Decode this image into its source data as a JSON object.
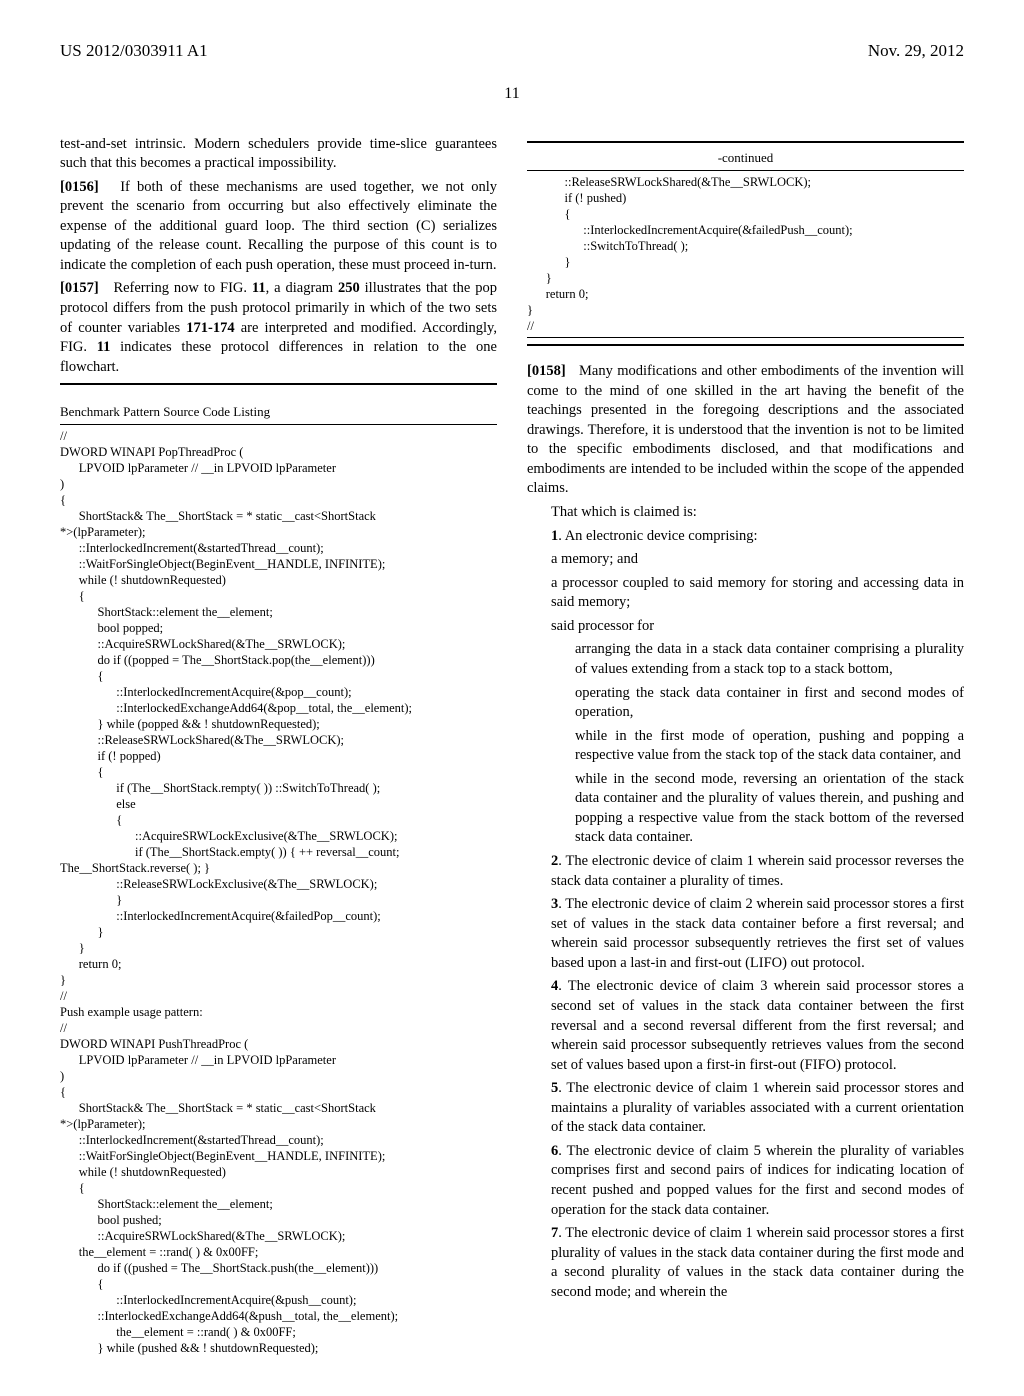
{
  "header": {
    "pub_number": "US 2012/0303911 A1",
    "pub_date": "Nov. 29, 2012"
  },
  "page_number": "11",
  "left": {
    "p1": "test-and-set intrinsic. Modern schedulers provide time-slice guarantees such that this becomes a practical impossibility.",
    "p2_num": "[0156]",
    "p2": "If both of these mechanisms are used together, we not only prevent the scenario from occurring but also effectively eliminate the expense of the additional guard loop. The third section (C) serializes updating of the release count. Recalling the purpose of this count is to indicate the completion of each push operation, these must proceed in-turn.",
    "p3_num": "[0157]",
    "p3a": "Referring now to FIG. ",
    "p3b": "11",
    "p3c": ", a diagram ",
    "p3d": "250",
    "p3e": " illustrates that the pop protocol differs from the push protocol primarily in which of the two sets of counter variables ",
    "p3f": "171-174",
    "p3g": " are interpreted and modified. Accordingly, FIG. ",
    "p3h": "11",
    "p3i": " indicates these protocol differences in relation to the one flowchart.",
    "code_title": "Benchmark Pattern Source Code Listing",
    "code": "//\nDWORD WINAPI PopThreadProc (\n      LPVOID lpParameter // __in LPVOID lpParameter\n)\n{\n      ShortStack& The__ShortStack = * static__cast<ShortStack\n*>(lpParameter);\n      ::InterlockedIncrement(&startedThread__count);\n      ::WaitForSingleObject(BeginEvent__HANDLE, INFINITE);\n      while (! shutdownRequested)\n      {\n            ShortStack::element the__element;\n            bool popped;\n            ::AcquireSRWLockShared(&The__SRWLOCK);\n            do if ((popped = The__ShortStack.pop(the__element)))\n            {\n                  ::InterlockedIncrementAcquire(&pop__count);\n                  ::InterlockedExchangeAdd64(&pop__total, the__element);\n            } while (popped && ! shutdownRequested);\n            ::ReleaseSRWLockShared(&The__SRWLOCK);\n            if (! popped)\n            {\n                  if (The__ShortStack.rempty( )) ::SwitchToThread( );\n                  else\n                  {\n                        ::AcquireSRWLockExclusive(&The__SRWLOCK);\n                        if (The__ShortStack.empty( )) { ++ reversal__count;\nThe__ShortStack.reverse( ); }\n                  ::ReleaseSRWLockExclusive(&The__SRWLOCK);\n                  }\n                  ::InterlockedIncrementAcquire(&failedPop__count);\n            }\n      }\n      return 0;\n}\n//\nPush example usage pattern:\n//\nDWORD WINAPI PushThreadProc (\n      LPVOID lpParameter // __in LPVOID lpParameter\n)\n{\n      ShortStack& The__ShortStack = * static__cast<ShortStack\n*>(lpParameter);\n      ::InterlockedIncrement(&startedThread__count);\n      ::WaitForSingleObject(BeginEvent__HANDLE, INFINITE);\n      while (! shutdownRequested)\n      {\n            ShortStack::element the__element;\n            bool pushed;\n            ::AcquireSRWLockShared(&The__SRWLOCK);\n      the__element = ::rand( ) & 0x00FF;\n            do if ((pushed = The__ShortStack.push(the__element)))\n            {\n                  ::InterlockedIncrementAcquire(&push__count);\n            ::InterlockedExchangeAdd64(&push__total, the__element);\n                  the__element = ::rand( ) & 0x00FF;\n            } while (pushed && ! shutdownRequested);"
  },
  "right": {
    "continued": "-continued",
    "code2": "            ::ReleaseSRWLockShared(&The__SRWLOCK);\n            if (! pushed)\n            {\n                  ::InterlockedIncrementAcquire(&failedPush__count);\n                  ::SwitchToThread( );\n            }\n      }\n      return 0;\n}\n//",
    "p4_num": "[0158]",
    "p4": "Many modifications and other embodiments of the invention will come to the mind of one skilled in the art having the benefit of the teachings presented in the foregoing descriptions and the associated drawings. Therefore, it is understood that the invention is not to be limited to the specific embodiments disclosed, and that modifications and embodiments are intended to be included within the scope of the appended claims.",
    "claimed": "That which is claimed is:",
    "c1_num": "1",
    "c1a": ". An electronic device comprising:",
    "c1b": "a memory; and",
    "c1c": "a processor coupled to said memory for storing and accessing data in said memory;",
    "c1d": "said processor for",
    "c1e": "arranging the data in a stack data container comprising a plurality of values extending from a stack top to a stack bottom,",
    "c1f": "operating the stack data container in first and second modes of operation,",
    "c1g": "while in the first mode of operation, pushing and popping a respective value from the stack top of the stack data container, and",
    "c1h": "while in the second mode, reversing an orientation of the stack data container and the plurality of values therein, and pushing and popping a respective value from the stack bottom of the reversed stack data container.",
    "c2_num": "2",
    "c2": ". The electronic device of claim 1 wherein said processor reverses the stack data container a plurality of times.",
    "c3_num": "3",
    "c3": ". The electronic device of claim 2 wherein said processor stores a first set of values in the stack data container before a first reversal; and wherein said processor subsequently retrieves the first set of values based upon a last-in and first-out (LIFO) out protocol.",
    "c4_num": "4",
    "c4": ". The electronic device of claim 3 wherein said processor stores a second set of values in the stack data container between the first reversal and a second reversal different from the first reversal; and wherein said processor subsequently retrieves values from the second set of values based upon a first-in first-out (FIFO) protocol.",
    "c5_num": "5",
    "c5": ". The electronic device of claim 1 wherein said processor stores and maintains a plurality of variables associated with a current orientation of the stack data container.",
    "c6_num": "6",
    "c6": ". The electronic device of claim 5 wherein the plurality of variables comprises first and second pairs of indices for indicating location of recent pushed and popped values for the first and second modes of operation for the stack data container.",
    "c7_num": "7",
    "c7": ". The electronic device of claim 1 wherein said processor stores a first plurality of values in the stack data container during the first mode and a second plurality of values in the stack data container during the second mode; and wherein the"
  }
}
